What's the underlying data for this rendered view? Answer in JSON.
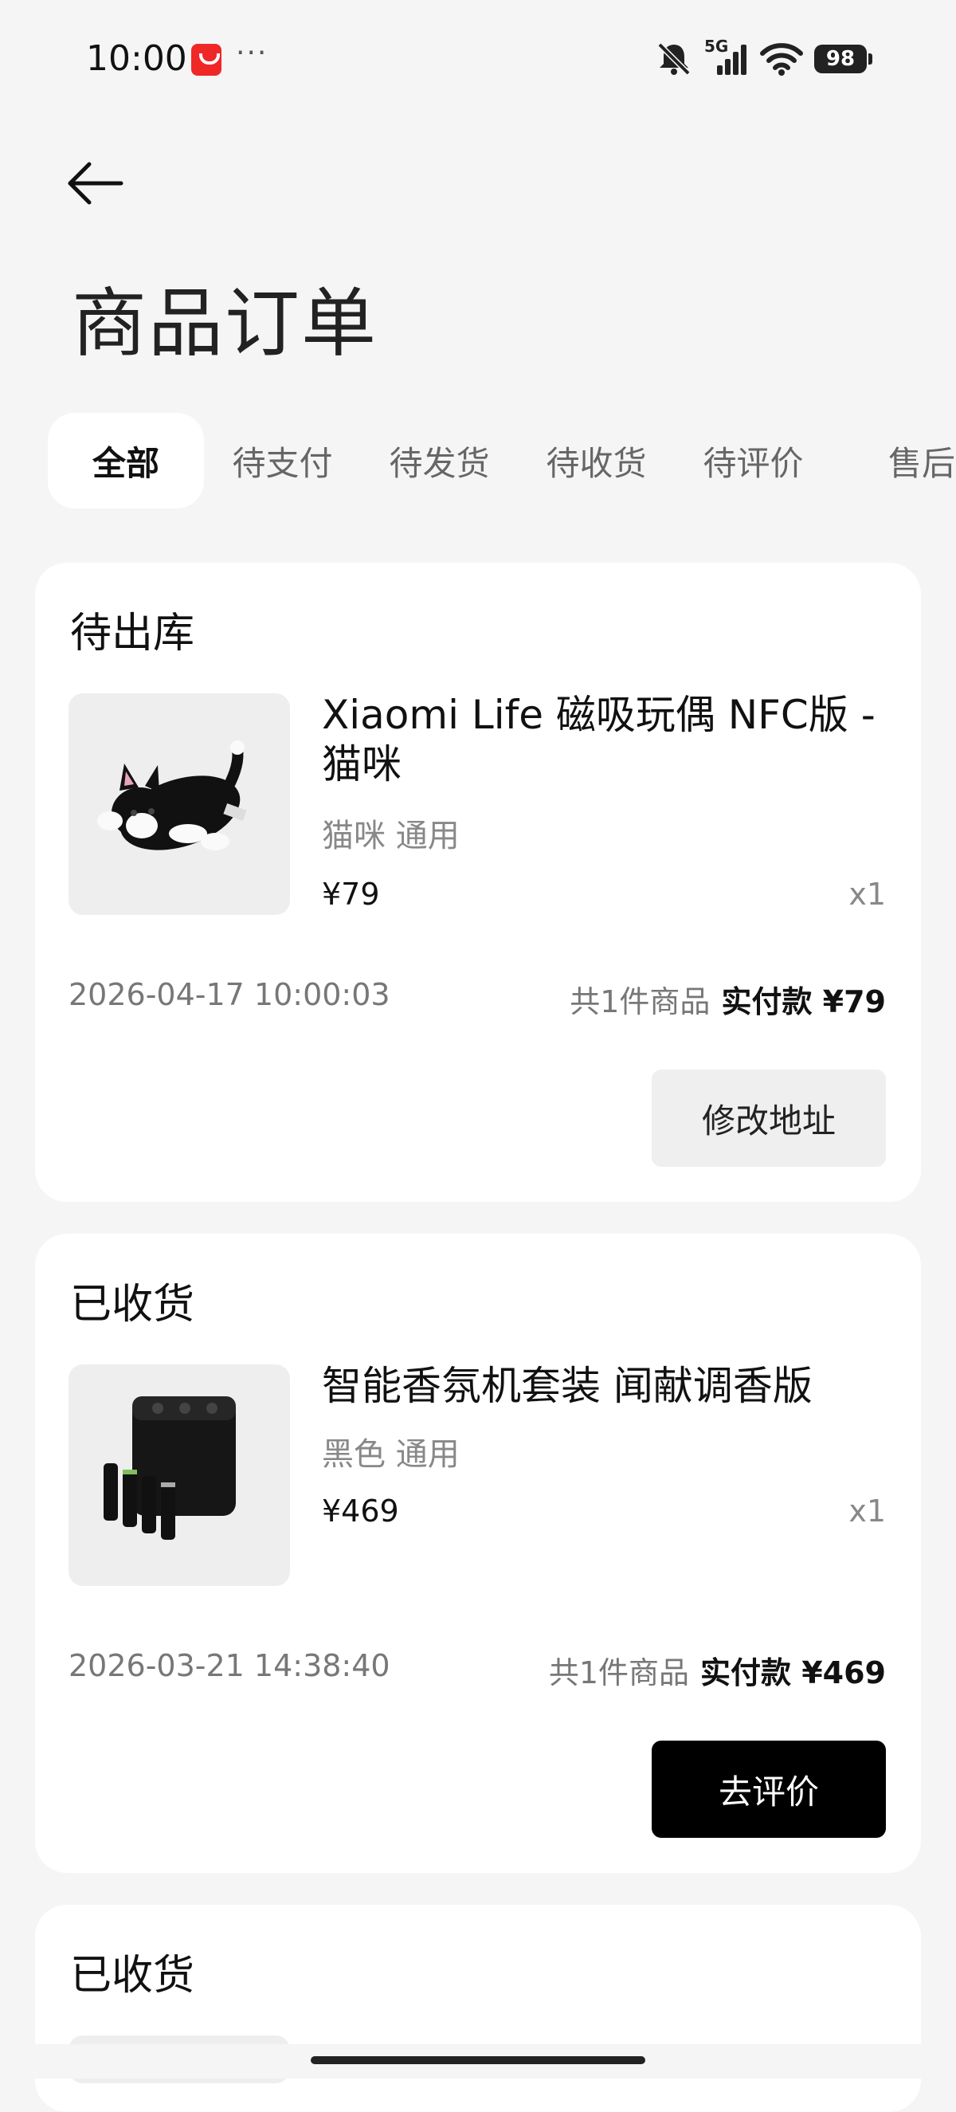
{
  "status_bar": {
    "time": "10:00",
    "more": "···",
    "network": "5G",
    "battery": "98"
  },
  "header": {
    "title": "商品订单"
  },
  "tabs": [
    {
      "label": "全部",
      "active": true
    },
    {
      "label": "待支付",
      "active": false
    },
    {
      "label": "待发货",
      "active": false
    },
    {
      "label": "待收货",
      "active": false
    },
    {
      "label": "待评价",
      "active": false
    },
    {
      "label": "售后",
      "active": false
    }
  ],
  "orders": [
    {
      "status": "待出库",
      "item_name": "Xiaomi Life 磁吸玩偶 NFC版 - 猫咪",
      "spec": "猫咪 通用",
      "price": "¥79",
      "qty": "x1",
      "date": "2026-04-17 10:00:03",
      "count_text": "共1件商品",
      "paid_text": "实付款 ¥79",
      "action": "修改地址"
    },
    {
      "status": "已收货",
      "item_name": "智能香氛机套装 闻献调香版",
      "spec": "黑色 通用",
      "price": "¥469",
      "qty": "x1",
      "date": "2026-03-21 14:38:40",
      "count_text": "共1件商品",
      "paid_text": "实付款 ¥469",
      "action": "去评价"
    },
    {
      "status": "已收货"
    }
  ],
  "colors": {
    "background": "#f5f5f5",
    "card": "#ffffff",
    "primary_button": "#000000",
    "secondary_button": "#efefef",
    "app_badge": "#f02727"
  }
}
